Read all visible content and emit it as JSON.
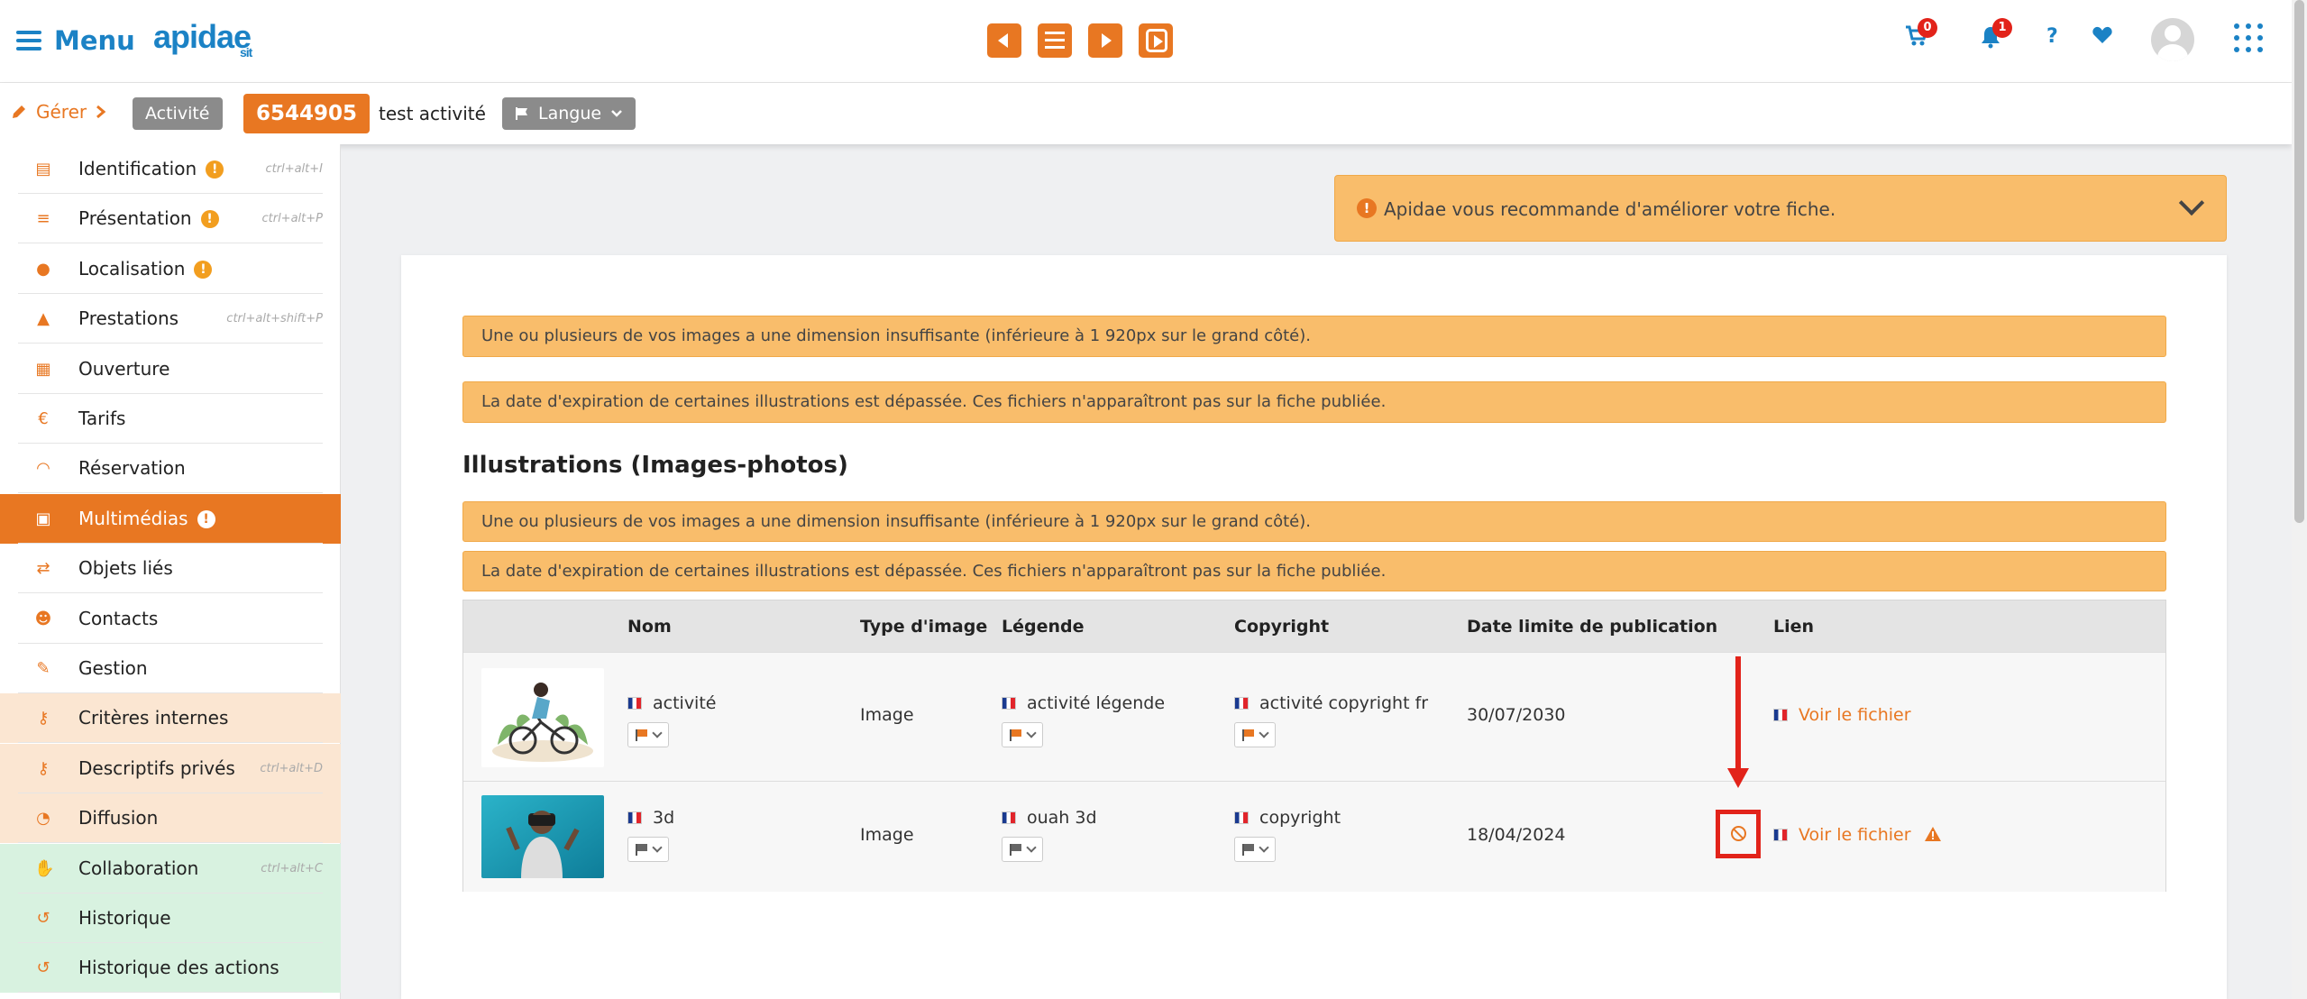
{
  "header": {
    "menu_label": "Menu",
    "logo_text": "apidae",
    "logo_sub": "sit",
    "cart_badge": "0",
    "notif_badge": "1",
    "help_label": "?"
  },
  "subheader": {
    "gerer_label": "Gérer",
    "type_label": "Activité",
    "id_label": "6544905",
    "object_name": "test activité",
    "langue_label": "Langue"
  },
  "sidebar": {
    "items": [
      {
        "label": "Identification",
        "warn": true,
        "shortcut": "ctrl+alt+I",
        "icon": "id-card-icon"
      },
      {
        "label": "Présentation",
        "warn": true,
        "shortcut": "ctrl+alt+P",
        "icon": "lines-icon"
      },
      {
        "label": "Localisation",
        "warn": true,
        "shortcut": "",
        "icon": "map-pin-icon"
      },
      {
        "label": "Prestations",
        "warn": false,
        "shortcut": "ctrl+alt+shift+P",
        "icon": "service-bell-icon"
      },
      {
        "label": "Ouverture",
        "warn": false,
        "shortcut": "",
        "icon": "calendar-icon"
      },
      {
        "label": "Tarifs",
        "warn": false,
        "shortcut": "",
        "icon": "euro-icon"
      },
      {
        "label": "Réservation",
        "warn": false,
        "shortcut": "",
        "icon": "headset-icon"
      },
      {
        "label": "Multimédias",
        "warn": true,
        "shortcut": "",
        "icon": "images-icon"
      },
      {
        "label": "Objets liés",
        "warn": false,
        "shortcut": "",
        "icon": "exchange-icon"
      },
      {
        "label": "Contacts",
        "warn": false,
        "shortcut": "",
        "icon": "users-icon"
      },
      {
        "label": "Gestion",
        "warn": false,
        "shortcut": "",
        "icon": "wrench-icon"
      },
      {
        "label": "Critères internes",
        "warn": false,
        "shortcut": "",
        "icon": "key-icon"
      },
      {
        "label": "Descriptifs privés",
        "warn": false,
        "shortcut": "ctrl+alt+D",
        "icon": "key-icon"
      },
      {
        "label": "Diffusion",
        "warn": false,
        "shortcut": "",
        "icon": "rss-icon"
      },
      {
        "label": "Collaboration",
        "warn": false,
        "shortcut": "ctrl+alt+C",
        "icon": "handshake-icon"
      },
      {
        "label": "Historique",
        "warn": false,
        "shortcut": "",
        "icon": "history-icon"
      },
      {
        "label": "Historique des actions",
        "warn": false,
        "shortcut": "",
        "icon": "history-icon"
      }
    ]
  },
  "recommend": {
    "text": "Apidae vous recommande d'améliorer votre fiche."
  },
  "alerts": {
    "dimension": "Une ou plusieurs de vos images a une dimension insuffisante (inférieure à 1 920px sur le grand côté).",
    "expiration": "La date d'expiration de certaines illustrations est dépassée. Ces fichiers n'apparaîtront pas sur la fiche publiée."
  },
  "section": {
    "title": "Illustrations (Images-photos)"
  },
  "table": {
    "headers": [
      "Nom",
      "Type d'image",
      "Légende",
      "Copyright",
      "Date limite de publication",
      "Lien"
    ],
    "rows": [
      {
        "nom": "activité",
        "type": "Image",
        "legende": "activité légende",
        "copyright": "activité copyright fr",
        "date": "30/07/2030",
        "lien": "Voir le fichier"
      },
      {
        "nom": "3d",
        "type": "Image",
        "legende": "ouah 3d",
        "copyright": "copyright",
        "date": "18/04/2024",
        "lien": "Voir le fichier"
      }
    ]
  },
  "colors": {
    "accent": "#e87722",
    "brand": "#1b82c5",
    "alert_bg": "#f9bd6b",
    "annotation": "#e2231a"
  }
}
